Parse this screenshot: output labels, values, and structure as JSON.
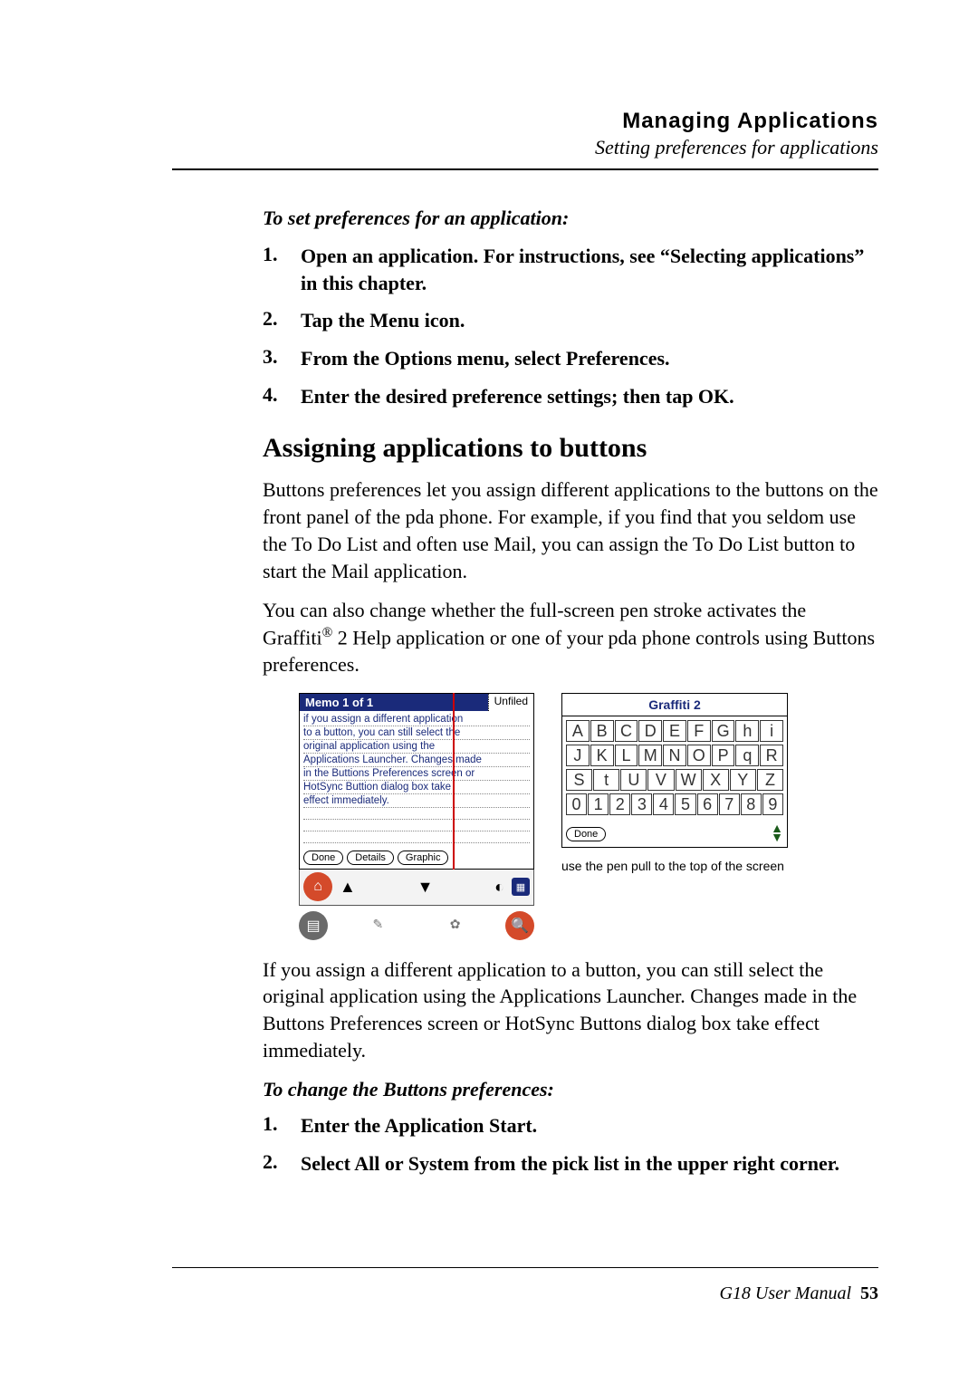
{
  "header": {
    "title": "Managing Applications",
    "subtitle": "Setting preferences for applications"
  },
  "section1": {
    "intro": "To set preferences for an application:",
    "steps": [
      "Open an application. For instructions, see “Selecting applications” in this chapter.",
      "Tap the Menu icon.",
      "From the Options menu, select Preferences.",
      "Enter the desired preference settings; then tap OK."
    ]
  },
  "h2": "Assigning applications to buttons",
  "para1": "Buttons preferences let you assign different applications to the buttons on the front panel of the pda phone. For example, if you find that you seldom use the To Do List and often use Mail, you can assign the To Do List button to start the Mail application.",
  "para2_a": "You can also change whether the full-screen pen stroke activates the Graffiti",
  "para2_reg": "®",
  "para2_b": " 2 Help application or one of your pda phone controls using Buttons preferences.",
  "memo": {
    "title": "Memo 1 of 1",
    "category": "Unfiled",
    "lines": [
      "if you assign a different application",
      "to a button, you can still select the",
      "original application using the",
      "Applications Launcher. Changes made",
      "in the Buttions Preferences screen or",
      "HotSync Buttion dialog box take",
      "effect immediately."
    ],
    "btn_done": "Done",
    "btn_details": "Details",
    "btn_graphic": "Graphic"
  },
  "graffiti": {
    "title": "Graffiti 2",
    "rows": [
      [
        "A",
        "B",
        "C",
        "D",
        "E",
        "F",
        "G",
        "h",
        "i"
      ],
      [
        "J",
        "K",
        "L",
        "M",
        "N",
        "O",
        "P",
        "q",
        "R"
      ],
      [
        "S",
        "t",
        "U",
        "V",
        "W",
        "X",
        "Y",
        "Z"
      ],
      [
        "0",
        "1",
        "2",
        "3",
        "4",
        "5",
        "6",
        "7",
        "8",
        "9"
      ]
    ],
    "done": "Done",
    "caption": "use the pen pull to the top of the screen"
  },
  "para3": "If you assign a different application to a button, you can still select the original application using the Applications Launcher. Changes made in the Buttons Preferences screen or HotSync Buttons dialog box take effect immediately.",
  "section2": {
    "intro": "To change the Buttons preferences:",
    "steps": [
      "Enter the Application Start.",
      "Select All or System from the pick list in the upper right corner."
    ]
  },
  "footer": {
    "manual": "G18 User Manual",
    "page": "53"
  }
}
